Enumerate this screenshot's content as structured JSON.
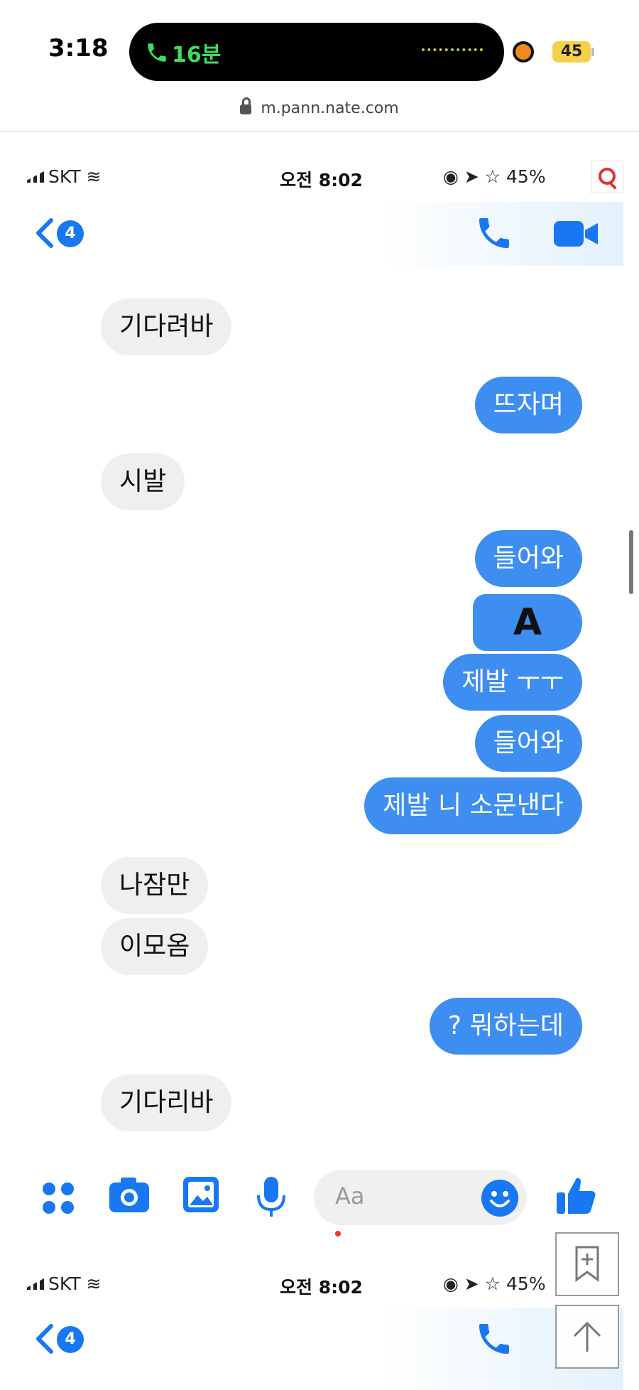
{
  "phone_status": {
    "time": "3:18",
    "call_duration": "16분",
    "battery": "45"
  },
  "browser": {
    "url": "m.pann.nate.com"
  },
  "screenshot_status": {
    "carrier": "SKT",
    "time": "오전 8:02",
    "battery": "45%"
  },
  "chat_header": {
    "unread_badge": "4"
  },
  "messages": [
    {
      "side": "in",
      "text": "기다려바"
    },
    {
      "side": "out",
      "text": "뜨자며"
    },
    {
      "side": "in",
      "text": "시발"
    },
    {
      "side": "out",
      "text": "들어와"
    },
    {
      "side": "out",
      "text": "A"
    },
    {
      "side": "out",
      "text": "제발 ㅜㅜ"
    },
    {
      "side": "out",
      "text": "들어와"
    },
    {
      "side": "out",
      "text": "제발 니 소문낸다"
    },
    {
      "side": "in",
      "text": "나잠만"
    },
    {
      "side": "in",
      "text": "이모옴"
    },
    {
      "side": "out",
      "text": "? 뭐하는데"
    },
    {
      "side": "in",
      "text": "기다리바"
    }
  ],
  "composer": {
    "placeholder": "Aa"
  },
  "second_screenshot": {
    "carrier": "SKT",
    "time": "오전 8:02",
    "battery": "45%",
    "unread_badge": "4"
  },
  "colors": {
    "accent": "#1877f2",
    "out_bubble": "#3d8ef0",
    "in_bubble": "#efefef",
    "call_green": "#3ddc5c"
  },
  "icons": [
    "phone-call-icon",
    "lock-icon",
    "signal-icon",
    "wifi-icon",
    "search-icon",
    "back-chevron-icon",
    "phone-icon",
    "video-camera-icon",
    "apps-grid-icon",
    "camera-icon",
    "gallery-icon",
    "microphone-icon",
    "smiley-icon",
    "thumbs-up-icon",
    "bookmark-add-icon",
    "scroll-top-icon"
  ]
}
